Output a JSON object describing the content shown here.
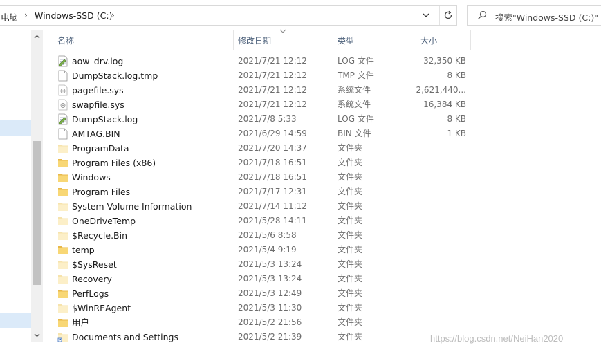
{
  "address": {
    "crumbs": [
      "电脑",
      "Windows-SSD (C:)"
    ],
    "separator": "›"
  },
  "search": {
    "placeholder": "搜索\"Windows-SSD (C:)\""
  },
  "columns": {
    "name": "名称",
    "date": "修改日期",
    "type": "类型",
    "size": "大小"
  },
  "files": [
    {
      "name": "aow_drv.log",
      "date": "2021/7/21 12:12",
      "type": "LOG 文件",
      "size": "32,350 KB",
      "icon": "log-file-icon"
    },
    {
      "name": "DumpStack.log.tmp",
      "date": "2021/7/21 12:12",
      "type": "TMP 文件",
      "size": "8 KB",
      "icon": "blank-file-icon"
    },
    {
      "name": "pagefile.sys",
      "date": "2021/7/21 12:12",
      "type": "系统文件",
      "size": "2,621,440...",
      "icon": "system-file-icon"
    },
    {
      "name": "swapfile.sys",
      "date": "2021/7/21 12:12",
      "type": "系统文件",
      "size": "16,384 KB",
      "icon": "system-file-icon"
    },
    {
      "name": "DumpStack.log",
      "date": "2021/7/8 5:33",
      "type": "LOG 文件",
      "size": "8 KB",
      "icon": "log-file-icon"
    },
    {
      "name": "AMTAG.BIN",
      "date": "2021/6/29 14:59",
      "type": "BIN 文件",
      "size": "1 KB",
      "icon": "blank-file-icon"
    },
    {
      "name": "ProgramData",
      "date": "2021/7/20 14:37",
      "type": "文件夹",
      "size": "",
      "icon": "hidden-folder-icon"
    },
    {
      "name": "Program Files (x86)",
      "date": "2021/7/18 16:51",
      "type": "文件夹",
      "size": "",
      "icon": "folder-icon"
    },
    {
      "name": "Windows",
      "date": "2021/7/18 16:51",
      "type": "文件夹",
      "size": "",
      "icon": "folder-icon"
    },
    {
      "name": "Program Files",
      "date": "2021/7/17 12:31",
      "type": "文件夹",
      "size": "",
      "icon": "folder-icon"
    },
    {
      "name": "System Volume Information",
      "date": "2021/7/14 11:12",
      "type": "文件夹",
      "size": "",
      "icon": "hidden-folder-icon"
    },
    {
      "name": "OneDriveTemp",
      "date": "2021/5/28 14:11",
      "type": "文件夹",
      "size": "",
      "icon": "hidden-folder-icon"
    },
    {
      "name": "$Recycle.Bin",
      "date": "2021/5/6 8:58",
      "type": "文件夹",
      "size": "",
      "icon": "hidden-folder-icon"
    },
    {
      "name": "temp",
      "date": "2021/5/4 9:19",
      "type": "文件夹",
      "size": "",
      "icon": "folder-icon"
    },
    {
      "name": "$SysReset",
      "date": "2021/5/3 13:24",
      "type": "文件夹",
      "size": "",
      "icon": "hidden-folder-icon"
    },
    {
      "name": "Recovery",
      "date": "2021/5/3 13:24",
      "type": "文件夹",
      "size": "",
      "icon": "hidden-folder-icon"
    },
    {
      "name": "PerfLogs",
      "date": "2021/5/3 12:49",
      "type": "文件夹",
      "size": "",
      "icon": "folder-icon"
    },
    {
      "name": "$WinREAgent",
      "date": "2021/5/3 11:30",
      "type": "文件夹",
      "size": "",
      "icon": "hidden-folder-icon"
    },
    {
      "name": "用户",
      "date": "2021/5/2 21:56",
      "type": "文件夹",
      "size": "",
      "icon": "folder-icon"
    },
    {
      "name": "Documents and Settings",
      "date": "2021/5/2 21:39",
      "type": "文件夹",
      "size": "",
      "icon": "shortcut-folder-icon"
    }
  ],
  "watermark": "https://blog.csdn.net/NeiHan2020",
  "colors": {
    "header_text": "#4c607a",
    "selection": "#dbeaf9",
    "folder": "#f8d775",
    "folder_dark": "#e8b84a"
  }
}
